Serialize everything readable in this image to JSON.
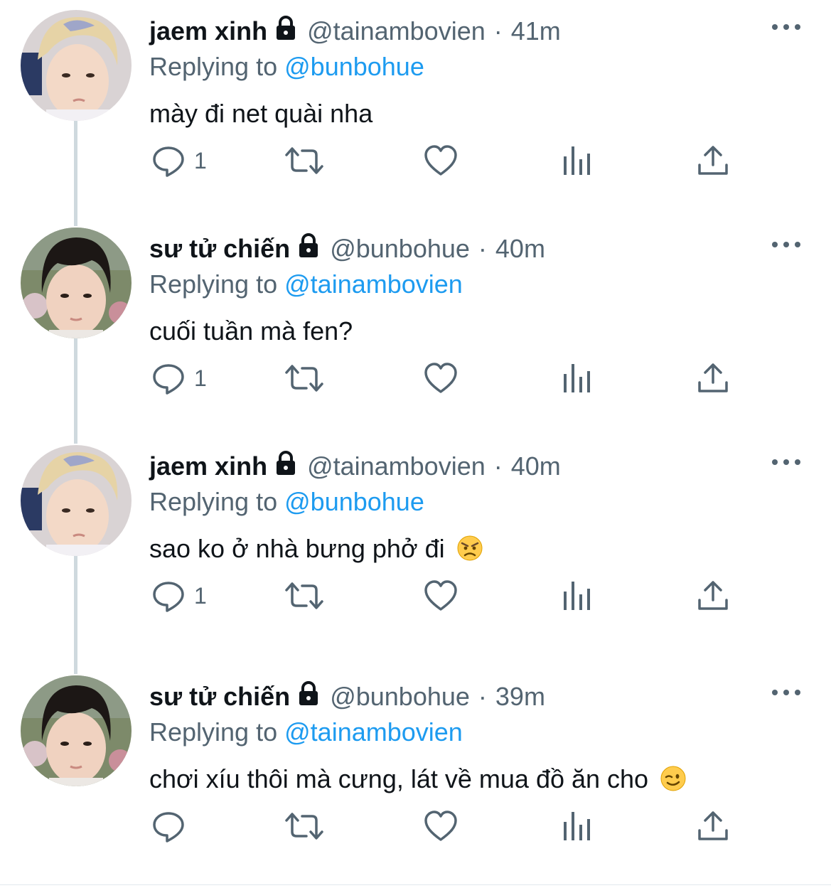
{
  "colors": {
    "text": "#0f1419",
    "secondary": "#536471",
    "link": "#1d9bf0",
    "thread_line": "#cfd9de"
  },
  "tweets": [
    {
      "name": "jaem xinh",
      "handle": "@tainambovien",
      "separator": "·",
      "time": "41m",
      "replying_label": "Replying to",
      "replying_to": "@bunbohue",
      "text": "mày đi net quài nha",
      "emoji": "",
      "reply_count": "1",
      "avatar": "blond-hair-avatar",
      "lock_icon": "lock-icon"
    },
    {
      "name": "sư tử chiến",
      "handle": "@bunbohue",
      "separator": "·",
      "time": "40m",
      "replying_label": "Replying to",
      "replying_to": "@tainambovien",
      "text": "cuối tuần mà fen?",
      "emoji": "",
      "reply_count": "1",
      "avatar": "dark-hair-avatar",
      "lock_icon": "lock-icon"
    },
    {
      "name": "jaem xinh",
      "handle": "@tainambovien",
      "separator": "·",
      "time": "40m",
      "replying_label": "Replying to",
      "replying_to": "@bunbohue",
      "text": "sao ko ở nhà bưng phở đi",
      "emoji": "angry-face-emoji",
      "reply_count": "1",
      "avatar": "blond-hair-avatar",
      "lock_icon": "lock-icon"
    },
    {
      "name": "sư tử chiến",
      "handle": "@bunbohue",
      "separator": "·",
      "time": "39m",
      "replying_label": "Replying to",
      "replying_to": "@tainambovien",
      "text": "chơi xíu thôi mà cưng, lát về mua đồ ăn cho",
      "emoji": "winking-face-emoji",
      "reply_count": "",
      "avatar": "dark-hair-avatar",
      "lock_icon": "lock-icon"
    }
  ],
  "action_icons": [
    "reply-icon",
    "retweet-icon",
    "like-icon",
    "views-icon",
    "share-icon"
  ]
}
